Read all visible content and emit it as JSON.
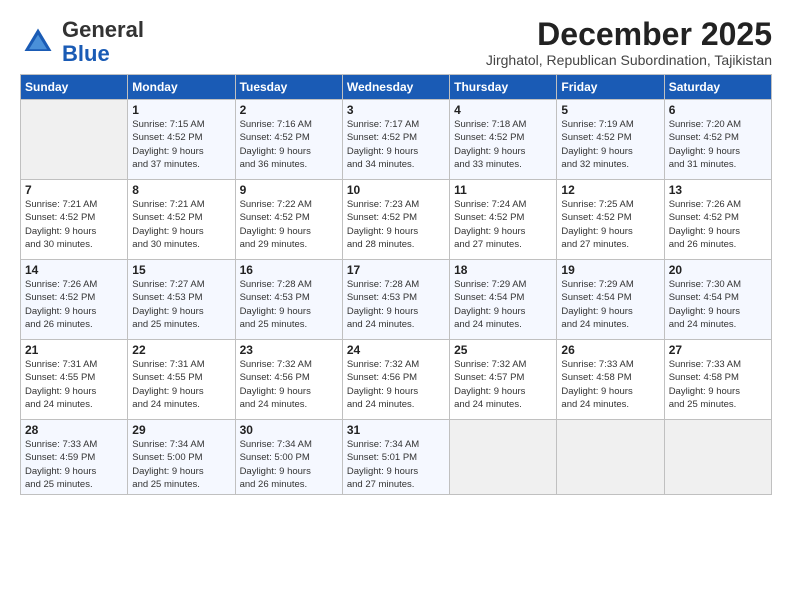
{
  "logo": {
    "general": "General",
    "blue": "Blue"
  },
  "header": {
    "month": "December 2025",
    "location": "Jirghatol, Republican Subordination, Tajikistan"
  },
  "days_of_week": [
    "Sunday",
    "Monday",
    "Tuesday",
    "Wednesday",
    "Thursday",
    "Friday",
    "Saturday"
  ],
  "weeks": [
    [
      {
        "day": "",
        "info": ""
      },
      {
        "day": "1",
        "info": "Sunrise: 7:15 AM\nSunset: 4:52 PM\nDaylight: 9 hours\nand 37 minutes."
      },
      {
        "day": "2",
        "info": "Sunrise: 7:16 AM\nSunset: 4:52 PM\nDaylight: 9 hours\nand 36 minutes."
      },
      {
        "day": "3",
        "info": "Sunrise: 7:17 AM\nSunset: 4:52 PM\nDaylight: 9 hours\nand 34 minutes."
      },
      {
        "day": "4",
        "info": "Sunrise: 7:18 AM\nSunset: 4:52 PM\nDaylight: 9 hours\nand 33 minutes."
      },
      {
        "day": "5",
        "info": "Sunrise: 7:19 AM\nSunset: 4:52 PM\nDaylight: 9 hours\nand 32 minutes."
      },
      {
        "day": "6",
        "info": "Sunrise: 7:20 AM\nSunset: 4:52 PM\nDaylight: 9 hours\nand 31 minutes."
      }
    ],
    [
      {
        "day": "7",
        "info": "Sunrise: 7:21 AM\nSunset: 4:52 PM\nDaylight: 9 hours\nand 30 minutes."
      },
      {
        "day": "8",
        "info": "Sunrise: 7:21 AM\nSunset: 4:52 PM\nDaylight: 9 hours\nand 30 minutes."
      },
      {
        "day": "9",
        "info": "Sunrise: 7:22 AM\nSunset: 4:52 PM\nDaylight: 9 hours\nand 29 minutes."
      },
      {
        "day": "10",
        "info": "Sunrise: 7:23 AM\nSunset: 4:52 PM\nDaylight: 9 hours\nand 28 minutes."
      },
      {
        "day": "11",
        "info": "Sunrise: 7:24 AM\nSunset: 4:52 PM\nDaylight: 9 hours\nand 27 minutes."
      },
      {
        "day": "12",
        "info": "Sunrise: 7:25 AM\nSunset: 4:52 PM\nDaylight: 9 hours\nand 27 minutes."
      },
      {
        "day": "13",
        "info": "Sunrise: 7:26 AM\nSunset: 4:52 PM\nDaylight: 9 hours\nand 26 minutes."
      }
    ],
    [
      {
        "day": "14",
        "info": "Sunrise: 7:26 AM\nSunset: 4:52 PM\nDaylight: 9 hours\nand 26 minutes."
      },
      {
        "day": "15",
        "info": "Sunrise: 7:27 AM\nSunset: 4:53 PM\nDaylight: 9 hours\nand 25 minutes."
      },
      {
        "day": "16",
        "info": "Sunrise: 7:28 AM\nSunset: 4:53 PM\nDaylight: 9 hours\nand 25 minutes."
      },
      {
        "day": "17",
        "info": "Sunrise: 7:28 AM\nSunset: 4:53 PM\nDaylight: 9 hours\nand 24 minutes."
      },
      {
        "day": "18",
        "info": "Sunrise: 7:29 AM\nSunset: 4:54 PM\nDaylight: 9 hours\nand 24 minutes."
      },
      {
        "day": "19",
        "info": "Sunrise: 7:29 AM\nSunset: 4:54 PM\nDaylight: 9 hours\nand 24 minutes."
      },
      {
        "day": "20",
        "info": "Sunrise: 7:30 AM\nSunset: 4:54 PM\nDaylight: 9 hours\nand 24 minutes."
      }
    ],
    [
      {
        "day": "21",
        "info": "Sunrise: 7:31 AM\nSunset: 4:55 PM\nDaylight: 9 hours\nand 24 minutes."
      },
      {
        "day": "22",
        "info": "Sunrise: 7:31 AM\nSunset: 4:55 PM\nDaylight: 9 hours\nand 24 minutes."
      },
      {
        "day": "23",
        "info": "Sunrise: 7:32 AM\nSunset: 4:56 PM\nDaylight: 9 hours\nand 24 minutes."
      },
      {
        "day": "24",
        "info": "Sunrise: 7:32 AM\nSunset: 4:56 PM\nDaylight: 9 hours\nand 24 minutes."
      },
      {
        "day": "25",
        "info": "Sunrise: 7:32 AM\nSunset: 4:57 PM\nDaylight: 9 hours\nand 24 minutes."
      },
      {
        "day": "26",
        "info": "Sunrise: 7:33 AM\nSunset: 4:58 PM\nDaylight: 9 hours\nand 24 minutes."
      },
      {
        "day": "27",
        "info": "Sunrise: 7:33 AM\nSunset: 4:58 PM\nDaylight: 9 hours\nand 25 minutes."
      }
    ],
    [
      {
        "day": "28",
        "info": "Sunrise: 7:33 AM\nSunset: 4:59 PM\nDaylight: 9 hours\nand 25 minutes."
      },
      {
        "day": "29",
        "info": "Sunrise: 7:34 AM\nSunset: 5:00 PM\nDaylight: 9 hours\nand 25 minutes."
      },
      {
        "day": "30",
        "info": "Sunrise: 7:34 AM\nSunset: 5:00 PM\nDaylight: 9 hours\nand 26 minutes."
      },
      {
        "day": "31",
        "info": "Sunrise: 7:34 AM\nSunset: 5:01 PM\nDaylight: 9 hours\nand 27 minutes."
      },
      {
        "day": "",
        "info": ""
      },
      {
        "day": "",
        "info": ""
      },
      {
        "day": "",
        "info": ""
      }
    ]
  ]
}
